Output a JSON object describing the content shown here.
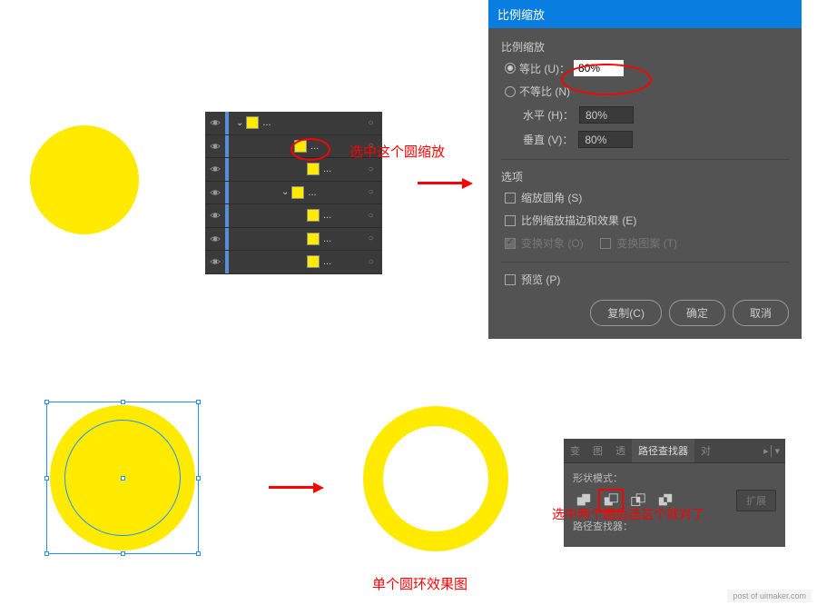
{
  "annotations": {
    "select_circle": "选中这个圆缩放",
    "ring_result": "单个圆环效果图",
    "pathfinder_tip": "选中两个圆后选这个就对了"
  },
  "dialog": {
    "title": "比例缩放",
    "section1_label": "比例缩放",
    "uniform_label": "等比 (U)：",
    "uniform_value": "80%",
    "nonuniform_label": "不等比 (N)",
    "horizontal_label": "水平 (H)：",
    "horizontal_value": "80%",
    "vertical_label": "垂直 (V)：",
    "vertical_value": "80%",
    "options_label": "选项",
    "scale_corners": "缩放圆角 (S)",
    "scale_strokes": "比例缩放描边和效果 (E)",
    "transform_objects": "变换对象 (O)",
    "transform_patterns": "变换图案 (T)",
    "preview": "预览 (P)",
    "copy_btn": "复制(C)",
    "ok_btn": "确定",
    "cancel_btn": "取消"
  },
  "layers": {
    "rows": [
      {
        "name": "...",
        "indent": 0,
        "toggle": true
      },
      {
        "name": "...",
        "indent": 1,
        "toggle": false
      },
      {
        "name": "...",
        "indent": 2,
        "toggle": false
      },
      {
        "name": "...",
        "indent": 1,
        "toggle": true
      },
      {
        "name": "...",
        "indent": 2,
        "toggle": false
      },
      {
        "name": "...",
        "indent": 2,
        "toggle": false
      },
      {
        "name": "...",
        "indent": 2,
        "toggle": false
      }
    ]
  },
  "pathfinder": {
    "tabs": {
      "t1": "变",
      "t2": "图",
      "t3": "透",
      "active": "路径查找器",
      "t4": "对"
    },
    "shape_modes_label": "形状模式：",
    "pathfinders_label": "路径查找器：",
    "expand": "扩展"
  },
  "watermark": "post of uimaker.com"
}
